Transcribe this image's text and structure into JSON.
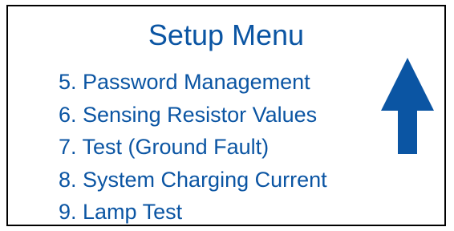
{
  "menu": {
    "title": "Setup Menu",
    "items": [
      {
        "label": "5. Password Management"
      },
      {
        "label": "6. Sensing Resistor Values"
      },
      {
        "label": "7. Test (Ground Fault)"
      },
      {
        "label": "8. System Charging Current"
      },
      {
        "label": "9. Lamp Test"
      }
    ]
  },
  "scroll_indicator": {
    "icon": "arrow-up-icon"
  },
  "colors": {
    "text": "#0b55a3",
    "arrow": "#0b55a3",
    "border": "#000000",
    "background": "#ffffff"
  }
}
